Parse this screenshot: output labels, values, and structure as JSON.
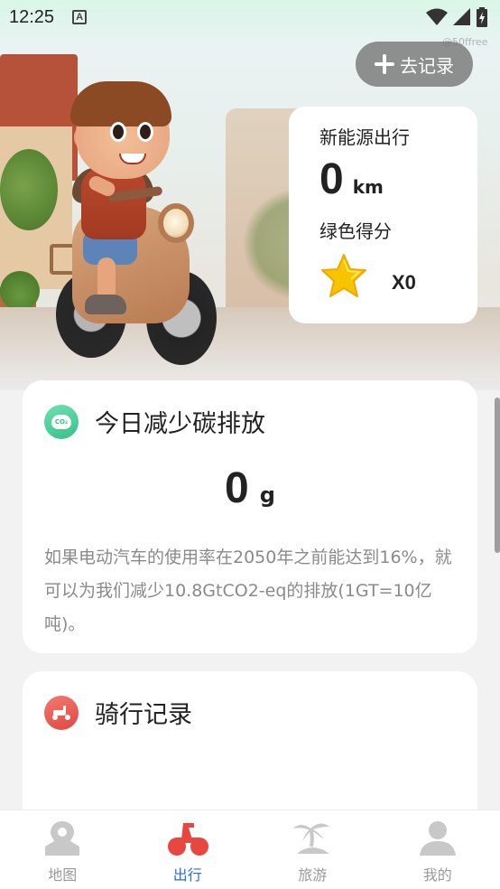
{
  "status_bar": {
    "time": "12:25",
    "a_icon_text": "A"
  },
  "watermark": "@50ffree",
  "hero": {
    "add_record_label": "去记录"
  },
  "stats_card": {
    "new_energy_label": "新能源出行",
    "distance_value": "0",
    "distance_unit": "km",
    "green_score_label": "绿色得分",
    "star_count": "X0"
  },
  "carbon_card": {
    "icon_text": "CO₂",
    "title": "今日减少碳排放",
    "value": "0",
    "unit": "g",
    "description": "如果电动汽车的使用率在2050年之前能达到16%，就可以为我们减少10.8GtCO2-eq的排放(1GT=10亿吨)。"
  },
  "ride_card": {
    "title": "骑行记录"
  },
  "bottom_nav": {
    "items": [
      {
        "label": "地图",
        "icon": "map-pin-icon"
      },
      {
        "label": "出行",
        "icon": "scooter-icon",
        "active": true
      },
      {
        "label": "旅游",
        "icon": "palm-island-icon"
      },
      {
        "label": "我的",
        "icon": "user-icon"
      }
    ],
    "active_color": "#2a6de0",
    "inactive_color": "#c8c8c8",
    "active_icon_color": "#e8473f"
  },
  "colors": {
    "co2_icon": "#36c08a",
    "ride_icon": "#e2463e",
    "star": "#f6c500"
  }
}
